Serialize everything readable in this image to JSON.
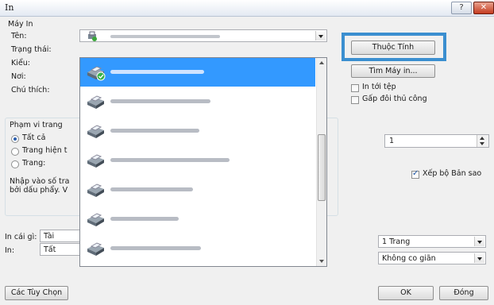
{
  "window": {
    "title": "In",
    "help_label": "?",
    "close_label": "✕"
  },
  "printer_group": {
    "title": "Máy In",
    "name_label": "Tên:",
    "status_label": "Trạng thái:",
    "type_label": "Kiểu:",
    "where_label": "Nơi:",
    "comment_label": "Chú thích:",
    "properties_button": "Thuộc Tính",
    "find_printer_button": "Tìm Máy in...",
    "print_to_file_label": "In tới tệp",
    "manual_duplex_label": "Gấp đôi thủ công"
  },
  "printer_list": {
    "items": [
      {
        "icon": "printer-icon",
        "selected": true
      },
      {
        "icon": "printer-icon",
        "selected": false
      },
      {
        "icon": "printer-icon",
        "selected": false
      },
      {
        "icon": "printer-icon",
        "selected": false
      },
      {
        "icon": "printer-icon",
        "selected": false
      },
      {
        "icon": "printer-icon",
        "selected": false
      },
      {
        "icon": "printer-icon",
        "selected": false
      }
    ]
  },
  "page_range": {
    "title": "Phạm vi trang",
    "all_label": "Tất cả",
    "current_label": "Trang hiện t",
    "pages_label": "Trang:",
    "hint_line1": "Nhập vào số tra",
    "hint_line2": "bởi dấu phẩy. V"
  },
  "copies": {
    "value": "1",
    "collate_label": "Xếp bộ Bản sao",
    "collate_checked": true
  },
  "print_what": {
    "label": "In cái gì:",
    "value": "Tài"
  },
  "print_scope": {
    "label": "In:",
    "value": "Tất"
  },
  "zoom": {
    "pages_per_sheet": "1 Trang",
    "scale": "Không co giãn"
  },
  "footer": {
    "options_button": "Các Tùy Chọn",
    "ok_button": "OK",
    "close_button": "Đóng"
  }
}
